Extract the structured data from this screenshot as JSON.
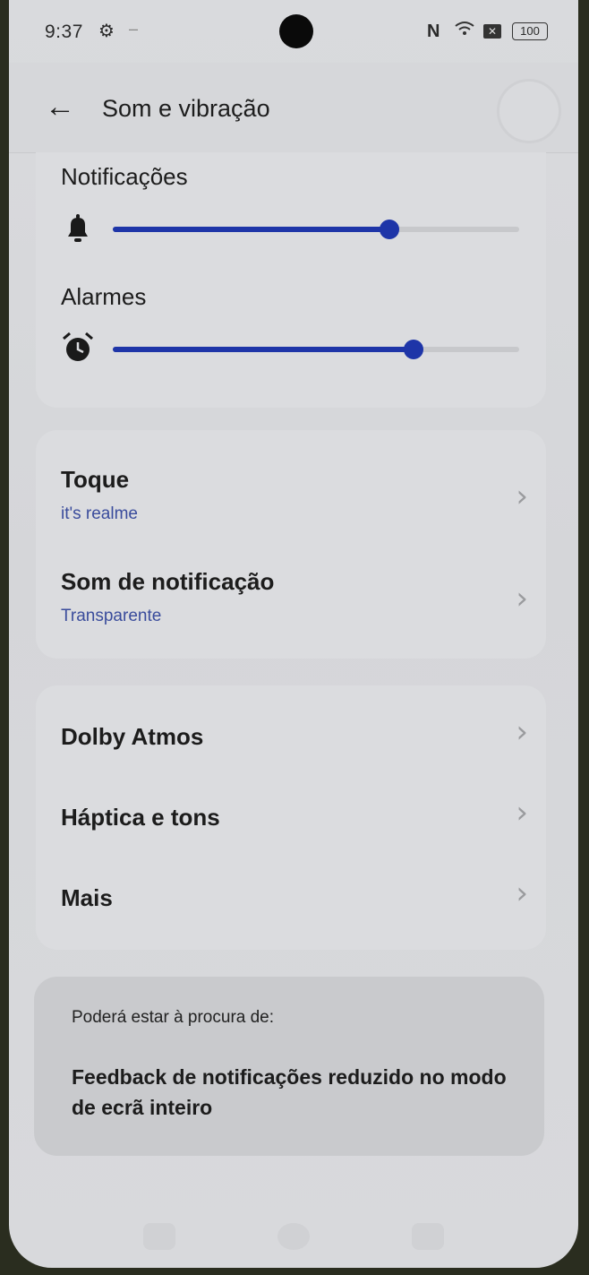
{
  "status_bar": {
    "time": "9:37",
    "gear_icon": "gear-icon",
    "dash": "–",
    "nfc": "N",
    "wifi_icon": "wifi-icon",
    "x_icon": "✕",
    "battery": "100"
  },
  "header": {
    "back_icon": "←",
    "title": "Som e vibração"
  },
  "volume": {
    "notifications": {
      "label": "Notificações",
      "icon": "bell-icon",
      "level": 0.68
    },
    "alarms": {
      "label": "Alarmes",
      "icon": "alarm-clock-icon",
      "level": 0.74
    }
  },
  "sound_settings": [
    {
      "title": "Toque",
      "subtitle": "it's realme"
    },
    {
      "title": "Som de notificação",
      "subtitle": "Transparente"
    }
  ],
  "more_settings": [
    {
      "title": "Dolby Atmos"
    },
    {
      "title": "Háptica e tons"
    },
    {
      "title": "Mais"
    }
  ],
  "suggestion": {
    "label": "Poderá estar à procura de:",
    "text": "Feedback de notificações reduzido no modo de ecrã inteiro"
  },
  "colors": {
    "accent": "#1e35a8",
    "subtitle": "#3a4c9c"
  }
}
